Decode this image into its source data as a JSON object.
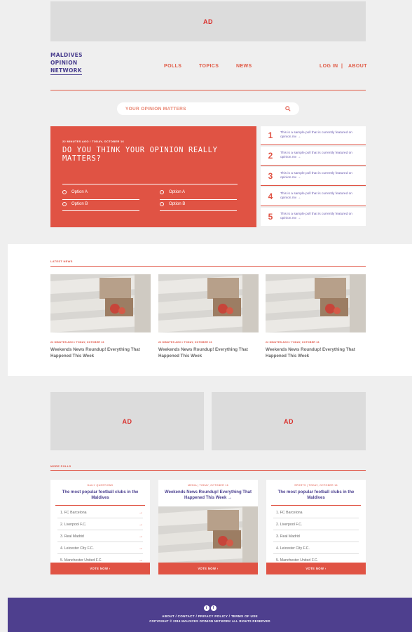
{
  "ads": {
    "top": "AD",
    "left": "AD",
    "right": "AD"
  },
  "logo": {
    "line1": "MALDIVES",
    "line2": "OPINION",
    "line3": "NETWORK"
  },
  "nav": {
    "polls": "POLLS",
    "topics": "TOPICS",
    "news": "NEWS",
    "login": "LOG IN",
    "divider": "|",
    "about": "ABOUT"
  },
  "search": {
    "placeholder": "YOUR OPINION MATTERS",
    "icon": "search-icon"
  },
  "feature": {
    "meta": "22 MINUTES AGO / TODAY, OCTOBER 16",
    "question": "DO YOU THINK YOUR OPINION REALLY MATTERS?",
    "options": [
      "Option A",
      "Option B",
      "Option A",
      "Option B"
    ]
  },
  "featured_polls": [
    {
      "num": "1",
      "text": "This is a sample poll that is currently featured on opinion.mv →"
    },
    {
      "num": "2",
      "text": "This is a sample poll that is currently featured on opinion.mv →"
    },
    {
      "num": "3",
      "text": "This is a sample poll that is currently featured on opinion.mv →"
    },
    {
      "num": "4",
      "text": "This is a sample poll that is currently featured on opinion.mv →"
    },
    {
      "num": "5",
      "text": "This is a sample poll that is currently featured on opinion.mv →"
    }
  ],
  "latest": {
    "label": "LATEST NEWS",
    "items": [
      {
        "meta": "22 MINUTES AGO / TODAY, OCTOBER 16",
        "title": "Weekends News Roundup! Everything That Happened This Week"
      },
      {
        "meta": "22 MINUTES AGO / TODAY, OCTOBER 16",
        "title": "Weekends News Roundup! Everything That Happened This Week"
      },
      {
        "meta": "22 MINUTES AGO / TODAY, OCTOBER 16",
        "title": "Weekends News Roundup! Everything That Happened This Week"
      }
    ]
  },
  "more_polls": {
    "label": "MORE POLLS",
    "cards": [
      {
        "tag": "DAILY QUESTIONS",
        "title": "The most popular football clubs in the Maldives",
        "rows": [
          "1. FC Barcelona",
          "2. Liverpool F.C.",
          "3. Real Madrid",
          "4. Leicester City F.C.",
          "5. Manchester United F.C."
        ],
        "vote": "VOTE NOW ›"
      },
      {
        "tag": "MEDIA | TODAY, OCTOBER 16",
        "title": "Weekends News Roundup! Everything That Happened This Week →",
        "rows": [],
        "vote": "VOTE NOW ›"
      },
      {
        "tag": "SPORTS | TODAY, OCTOBER 16",
        "title": "The most popular football clubs in the Maldives",
        "rows": [
          "1. FC Barcelona",
          "2. Liverpool F.C.",
          "3. Real Madrid",
          "4. Leicester City F.C.",
          "5. Manchester United F.C."
        ],
        "vote": "VOTE NOW ›"
      }
    ],
    "arrow": "→"
  },
  "footer": {
    "icons": [
      "twitter-icon",
      "facebook-icon"
    ],
    "links": "ABOUT / CONTACT / PRIVACY POLICY / TERMS OF USE",
    "copyright": "COPYRIGHT © 2019 MALDIVES OPINION NETWORK ALL RIGHTS RESERVED"
  },
  "colors": {
    "accent": "#e05344",
    "brand": "#4e3f8e",
    "ad_bg": "#dcdcdc"
  }
}
